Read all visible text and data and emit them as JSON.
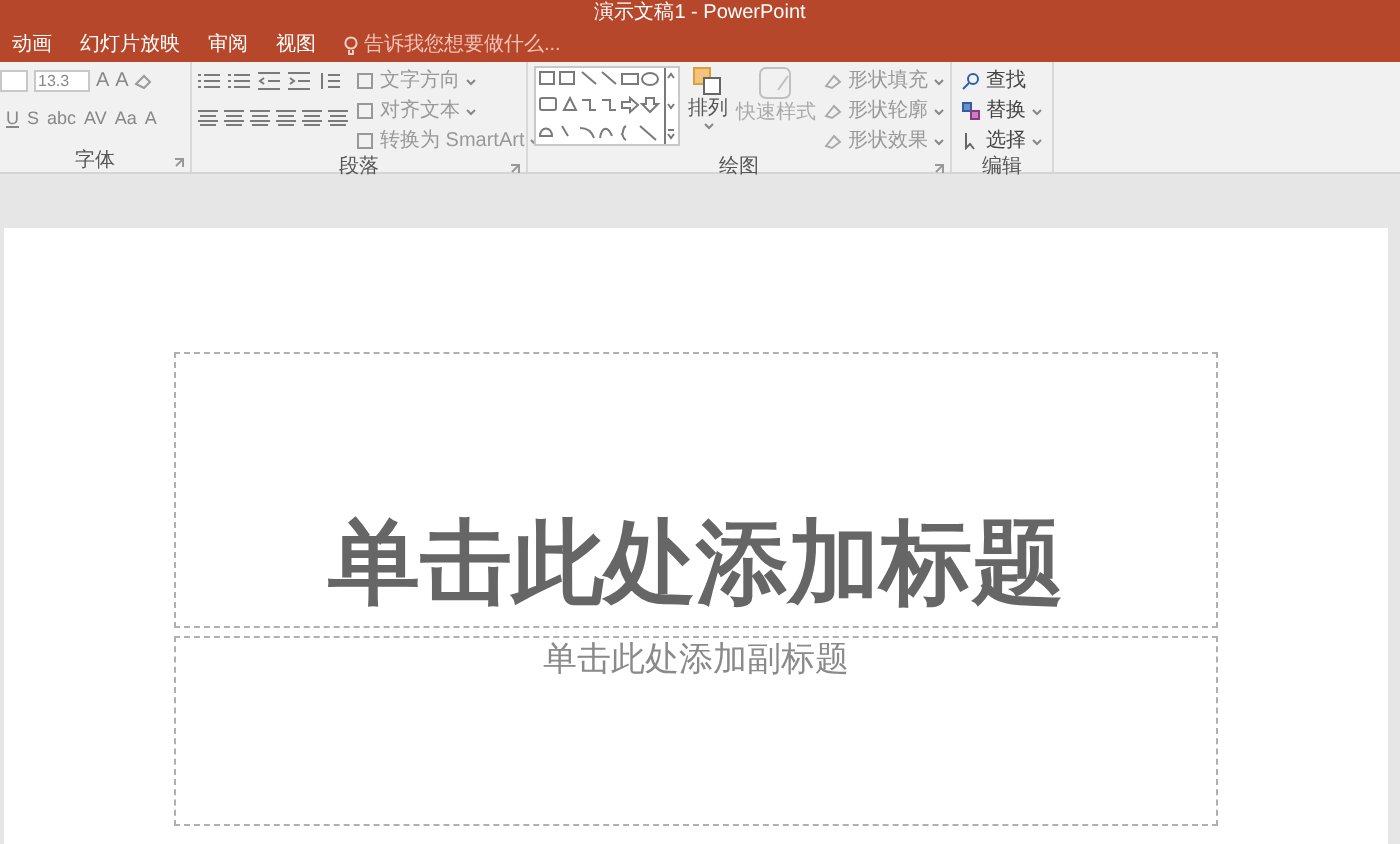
{
  "window": {
    "title": "演示文稿1 - PowerPoint"
  },
  "tabs": [
    {
      "label": "动画",
      "selected": false
    },
    {
      "label": "幻灯片放映",
      "selected": false
    },
    {
      "label": "审阅",
      "selected": false
    },
    {
      "label": "视图",
      "selected": false
    }
  ],
  "tell_me": {
    "placeholder": "告诉我您想要做什么..."
  },
  "ribbon": {
    "groups": [
      {
        "kind": "font",
        "label": "字体",
        "font_size": "13.3",
        "size_buttons": [
          "A",
          "A"
        ],
        "format_buttons": [
          "U",
          "S",
          "abc",
          "AV",
          "Aa",
          "A"
        ]
      },
      {
        "kind": "paragraph",
        "label": "段落",
        "commands": [
          "文字方向",
          "对齐文本",
          "转换为 SmartArt"
        ]
      },
      {
        "kind": "drawing",
        "label": "绘图",
        "commands": [
          "排列",
          "快速样式"
        ],
        "shape_commands": [
          "形状填充",
          "形状轮廓",
          "形状效果"
        ]
      },
      {
        "kind": "editing",
        "label": "编辑",
        "commands": [
          "查找",
          "替换",
          "选择"
        ]
      }
    ]
  },
  "slide": {
    "title_placeholder": "单击此处添加标题",
    "subtitle_placeholder": "单击此处添加副标题"
  }
}
